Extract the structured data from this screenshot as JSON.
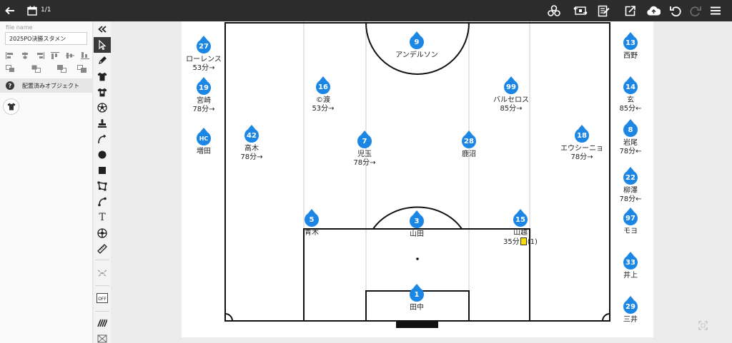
{
  "topbar": {
    "page_count": "1/1"
  },
  "left_panel": {
    "file_name_label": "file name",
    "file_name_value": "2025PO決勝スタメン",
    "placed_objects_label": "配置済みオブジェクト",
    "help_glyph": "?"
  },
  "tools": [
    "collapse-icon",
    "cursor-icon",
    "pen-icon",
    "shirt-icon",
    "shirt-alt-icon",
    "ball-icon",
    "stamp-icon",
    "curve-arrow-icon",
    "circle-icon",
    "square-icon",
    "polygon-icon",
    "line-icon",
    "text-icon",
    "ball-alt-icon",
    "ruler-icon",
    "formation-icon",
    "toggle-off-icon",
    "pattern-icon",
    "grid-icon"
  ],
  "tool_text_glyph": "T",
  "off_label": "OFF",
  "players": [
    {
      "num": "9",
      "name": "アンデルソン",
      "sub": ""
    },
    {
      "num": "16",
      "name": "©渡",
      "sub": "53分→"
    },
    {
      "num": "99",
      "name": "バルセロス",
      "sub": "85分→"
    },
    {
      "num": "42",
      "name": "高木",
      "sub": "78分→"
    },
    {
      "num": "7",
      "name": "児玉",
      "sub": "78分→"
    },
    {
      "num": "28",
      "name": "鹿沼",
      "sub": ""
    },
    {
      "num": "18",
      "name": "エウシーニョ",
      "sub": "78分→"
    },
    {
      "num": "5",
      "name": "青木",
      "sub": ""
    },
    {
      "num": "3",
      "name": "山田",
      "sub": ""
    },
    {
      "num": "15",
      "name": "山越",
      "sub": "35分",
      "card_suffix": "(1)"
    },
    {
      "num": "1",
      "name": "田中",
      "sub": ""
    }
  ],
  "subs_left": [
    {
      "num": "27",
      "name": "ローレンス",
      "sub": "53分→"
    },
    {
      "num": "19",
      "name": "宮崎",
      "sub": "78分→"
    },
    {
      "num": "HC",
      "name": "増田",
      "sub": ""
    }
  ],
  "subs_right": [
    {
      "num": "13",
      "name": "西野",
      "sub": ""
    },
    {
      "num": "14",
      "name": "玄",
      "sub": "85分←"
    },
    {
      "num": "8",
      "name": "岩尾",
      "sub": "78分←"
    },
    {
      "num": "22",
      "name": "柳澤",
      "sub": "78分←"
    },
    {
      "num": "97",
      "name": "モヨ",
      "sub": ""
    },
    {
      "num": "33",
      "name": "井上",
      "sub": ""
    },
    {
      "num": "29",
      "name": "三井",
      "sub": ""
    }
  ],
  "colors": {
    "badge": "#1b86e4",
    "topbar": "#2c2c2c",
    "yellow_card": "#f5dc00"
  }
}
